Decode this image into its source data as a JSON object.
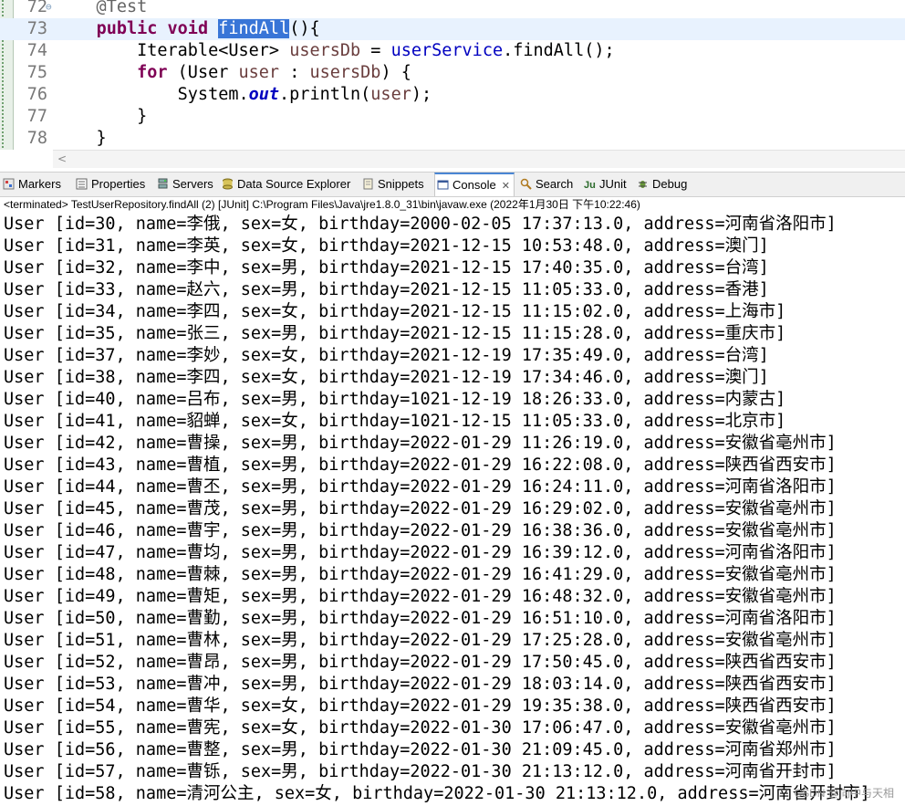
{
  "editor": {
    "lines": [
      {
        "num": "72",
        "tokens": [
          [
            "ann",
            "    @Test"
          ]
        ]
      },
      {
        "num": "73",
        "current": true,
        "tokens": [
          [
            "plain",
            "    "
          ],
          [
            "kw",
            "public"
          ],
          [
            "plain",
            " "
          ],
          [
            "kw",
            "void"
          ],
          [
            "plain",
            " "
          ],
          [
            "sel",
            "findAll"
          ],
          [
            "plain",
            "(){"
          ]
        ]
      },
      {
        "num": "74",
        "tokens": [
          [
            "plain",
            "        Iterable<User> "
          ],
          [
            "var",
            "usersDb"
          ],
          [
            "plain",
            " = "
          ],
          [
            "hl",
            "userService"
          ],
          [
            "plain",
            ".findAll();"
          ]
        ]
      },
      {
        "num": "75",
        "tokens": [
          [
            "plain",
            "        "
          ],
          [
            "kw",
            "for"
          ],
          [
            "plain",
            " (User "
          ],
          [
            "var",
            "user"
          ],
          [
            "plain",
            " : "
          ],
          [
            "var",
            "usersDb"
          ],
          [
            "plain",
            ") {"
          ]
        ]
      },
      {
        "num": "76",
        "tokens": [
          [
            "plain",
            "            System."
          ],
          [
            "field",
            "out"
          ],
          [
            "plain",
            ".println("
          ],
          [
            "var",
            "user"
          ],
          [
            "plain",
            ");"
          ]
        ]
      },
      {
        "num": "77",
        "tokens": [
          [
            "plain",
            "        }"
          ]
        ]
      },
      {
        "num": "78",
        "tokens": [
          [
            "plain",
            "    }"
          ]
        ]
      }
    ],
    "scroll_left_glyph": "<"
  },
  "views": {
    "tabs": [
      {
        "label": "Markers",
        "icon": "markers-icon",
        "active": false
      },
      {
        "label": "Properties",
        "icon": "properties-icon",
        "active": false
      },
      {
        "label": "Servers",
        "icon": "servers-icon",
        "active": false
      },
      {
        "label": "Data Source Explorer",
        "icon": "data-source-icon",
        "active": false
      },
      {
        "label": "Snippets",
        "icon": "snippets-icon",
        "active": false
      },
      {
        "label": "Console",
        "icon": "console-icon",
        "active": true,
        "close": "✕"
      },
      {
        "label": "Search",
        "icon": "search-icon",
        "active": false
      },
      {
        "label": "JUnit",
        "icon": "junit-icon",
        "active": false
      },
      {
        "label": "Debug",
        "icon": "debug-icon",
        "active": false
      }
    ]
  },
  "console": {
    "header": "<terminated> TestUserRepository.findAll (2) [JUnit] C:\\Program Files\\Java\\jre1.8.0_31\\bin\\javaw.exe  (2022年1月30日 下午10:22:46)",
    "lines": [
      "User [id=30, name=李俄, sex=女, birthday=2000-02-05 17:37:13.0, address=河南省洛阳市]",
      "User [id=31, name=李英, sex=女, birthday=2021-12-15 10:53:48.0, address=澳门]",
      "User [id=32, name=李中, sex=男, birthday=2021-12-15 17:40:35.0, address=台湾]",
      "User [id=33, name=赵六, sex=男, birthday=2021-12-15 11:05:33.0, address=香港]",
      "User [id=34, name=李四, sex=女, birthday=2021-12-15 11:15:02.0, address=上海市]",
      "User [id=35, name=张三, sex=男, birthday=2021-12-15 11:15:28.0, address=重庆市]",
      "User [id=37, name=李妙, sex=女, birthday=2021-12-19 17:35:49.0, address=台湾]",
      "User [id=38, name=李四, sex=女, birthday=2021-12-19 17:34:46.0, address=澳门]",
      "User [id=40, name=吕布, sex=男, birthday=1021-12-19 18:26:33.0, address=内蒙古]",
      "User [id=41, name=貂蝉, sex=女, birthday=1021-12-15 11:05:33.0, address=北京市]",
      "User [id=42, name=曹操, sex=男, birthday=2022-01-29 11:26:19.0, address=安徽省亳州市]",
      "User [id=43, name=曹植, sex=男, birthday=2022-01-29 16:22:08.0, address=陕西省西安市]",
      "User [id=44, name=曹丕, sex=男, birthday=2022-01-29 16:24:11.0, address=河南省洛阳市]",
      "User [id=45, name=曹茂, sex=男, birthday=2022-01-29 16:29:02.0, address=安徽省亳州市]",
      "User [id=46, name=曹宇, sex=男, birthday=2022-01-29 16:38:36.0, address=安徽省亳州市]",
      "User [id=47, name=曹均, sex=男, birthday=2022-01-29 16:39:12.0, address=河南省洛阳市]",
      "User [id=48, name=曹棘, sex=男, birthday=2022-01-29 16:41:29.0, address=安徽省亳州市]",
      "User [id=49, name=曹矩, sex=男, birthday=2022-01-29 16:48:32.0, address=安徽省亳州市]",
      "User [id=50, name=曹勤, sex=男, birthday=2022-01-29 16:51:10.0, address=河南省洛阳市]",
      "User [id=51, name=曹林, sex=男, birthday=2022-01-29 17:25:28.0, address=安徽省亳州市]",
      "User [id=52, name=曹昂, sex=男, birthday=2022-01-29 17:50:45.0, address=陕西省西安市]",
      "User [id=53, name=曹冲, sex=男, birthday=2022-01-29 18:03:14.0, address=陕西省西安市]",
      "User [id=54, name=曹华, sex=女, birthday=2022-01-29 19:35:38.0, address=陕西省西安市]",
      "User [id=55, name=曹宪, sex=女, birthday=2022-01-30 17:06:47.0, address=安徽省亳州市]",
      "User [id=56, name=曹整, sex=男, birthday=2022-01-30 21:09:45.0, address=河南省郑州市]",
      "User [id=57, name=曹铄, sex=男, birthday=2022-01-30 21:13:12.0, address=河南省开封市]",
      "User [id=58, name=清河公主, sex=女, birthday=2022-01-30 21:13:12.0, address=河南省开封市]"
    ]
  },
  "watermark": "CSDN @向中与天相"
}
